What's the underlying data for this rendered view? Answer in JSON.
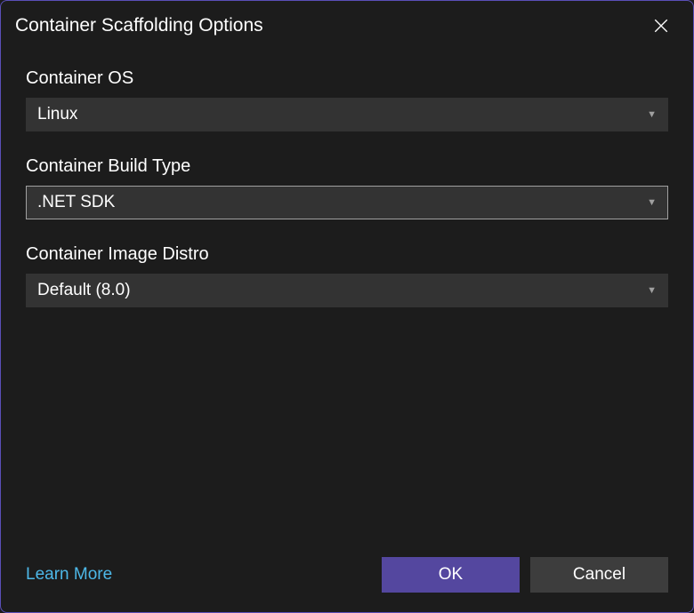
{
  "dialog": {
    "title": "Container Scaffolding Options"
  },
  "fields": {
    "os": {
      "label": "Container OS",
      "value": "Linux"
    },
    "buildType": {
      "label": "Container Build Type",
      "value": ".NET SDK"
    },
    "imageDistro": {
      "label": "Container Image Distro",
      "value": "Default (8.0)"
    }
  },
  "footer": {
    "learnMore": "Learn More",
    "ok": "OK",
    "cancel": "Cancel"
  }
}
